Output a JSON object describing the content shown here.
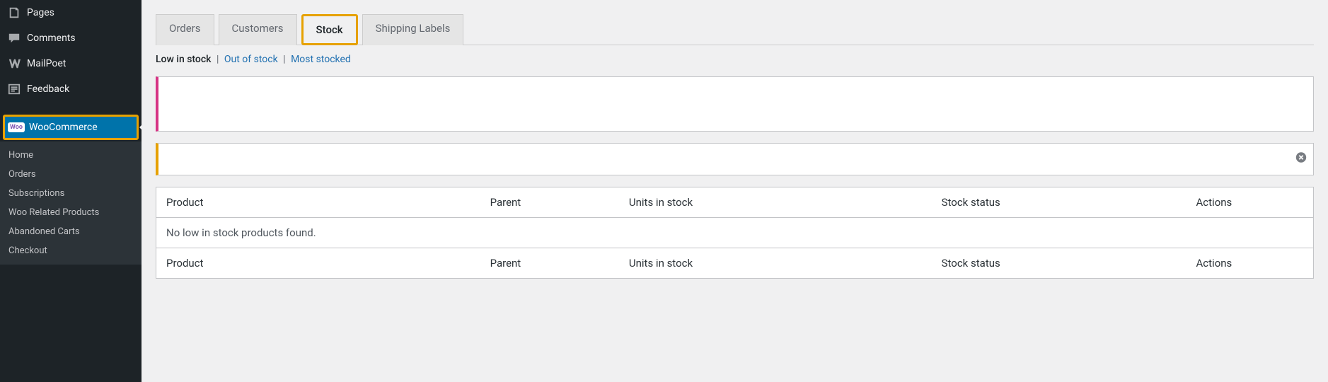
{
  "sidebar": {
    "items": [
      {
        "label": "Pages",
        "icon": "pages"
      },
      {
        "label": "Comments",
        "icon": "comment"
      },
      {
        "label": "MailPoet",
        "icon": "mailpoet"
      },
      {
        "label": "Feedback",
        "icon": "feedback"
      },
      {
        "label": "WooCommerce",
        "icon": "woo",
        "current": true,
        "highlight": true
      }
    ],
    "submenu": [
      {
        "label": "Home"
      },
      {
        "label": "Orders"
      },
      {
        "label": "Subscriptions"
      },
      {
        "label": "Woo Related Products"
      },
      {
        "label": "Abandoned Carts"
      },
      {
        "label": "Checkout"
      }
    ]
  },
  "tabs": [
    {
      "label": "Orders"
    },
    {
      "label": "Customers"
    },
    {
      "label": "Stock",
      "active": true,
      "highlight": true
    },
    {
      "label": "Shipping Labels"
    }
  ],
  "subsub": {
    "current": "Low in stock",
    "link1": "Out of stock",
    "link2": "Most stocked"
  },
  "table": {
    "columns": [
      "Product",
      "Parent",
      "Units in stock",
      "Stock status",
      "Actions"
    ],
    "empty_message": "No low in stock products found."
  }
}
